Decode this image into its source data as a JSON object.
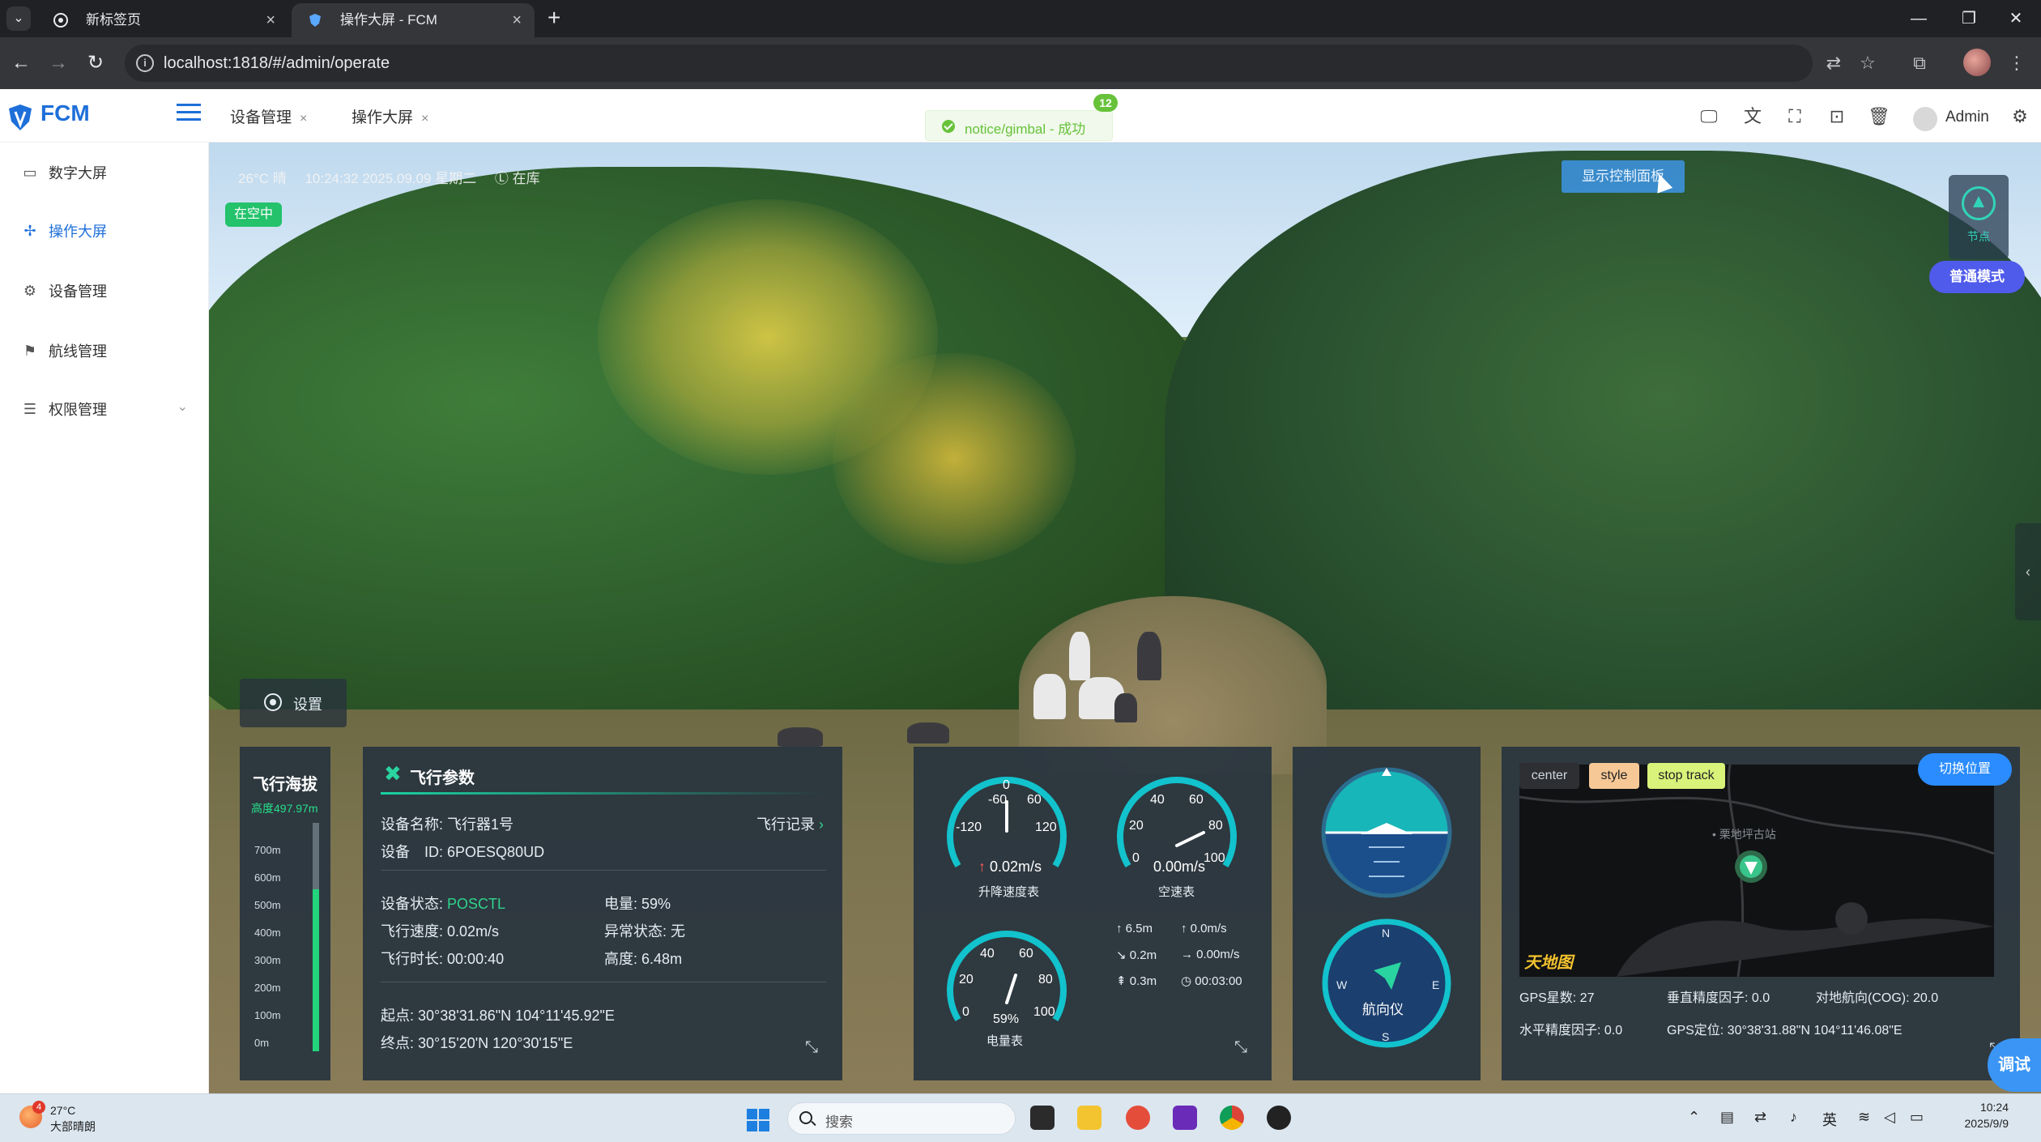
{
  "browser": {
    "tabs": [
      {
        "title": "新标签页",
        "active": false
      },
      {
        "title": "操作大屏 - FCM",
        "active": true
      }
    ],
    "url": "localhost:1818/#/admin/operate",
    "menu_glyph": "⌄",
    "close_glyph": "×",
    "newtab_glyph": "+",
    "back_glyph": "←",
    "forward_glyph": "→",
    "reload_glyph": "↻",
    "info_glyph": "i",
    "min_glyph": "—",
    "max_glyph": "❐",
    "win_close_glyph": "✕"
  },
  "app": {
    "logo": "FCM",
    "tabs": [
      {
        "label": "设备管理"
      },
      {
        "label": "操作大屏"
      }
    ],
    "tab_close": "×",
    "user": "Admin",
    "header_icons": [
      "monitor-icon",
      "translate-icon",
      "fullscreen-icon",
      "terminal-icon",
      "trash-icon",
      "settings-gear-icon"
    ]
  },
  "toast": {
    "message": "notice/gimbal - 成功",
    "badge": "12"
  },
  "sidebar": {
    "items": [
      {
        "label": "数字大屏",
        "icon": "dashboard-icon",
        "glyph": "▭"
      },
      {
        "label": "操作大屏",
        "icon": "crosshair-icon",
        "glyph": "✢",
        "active": true
      },
      {
        "label": "设备管理",
        "icon": "gear-icon",
        "glyph": "⚙"
      },
      {
        "label": "航线管理",
        "icon": "flag-icon",
        "glyph": "⚑"
      },
      {
        "label": "权限管理",
        "icon": "sliders-icon",
        "glyph": "☰",
        "expandable": true
      }
    ],
    "chevron_glyph": "⌄"
  },
  "video": {
    "osd": [
      "26°C 晴",
      "10:24:32 2025.09.09 星期二",
      "Ⓛ 在库"
    ],
    "status_badge": "在空中",
    "show_panel_button": "显示控制面板",
    "node_label": "节点",
    "mode_button": "普通模式",
    "collapse_glyph": "‹",
    "settings_label": "设置"
  },
  "altitude_panel": {
    "title": "飞行海拔",
    "value": "高度497.97m",
    "ticks": [
      "700m",
      "600m",
      "500m",
      "400m",
      "300m",
      "200m",
      "100m",
      "0m"
    ],
    "level": 0.71
  },
  "flight_params": {
    "title": "飞行参数",
    "device_name_label": "设备名称:",
    "device_name": "飞行器1号",
    "device_id_label": "设备　ID:",
    "device_id": "6POESQ80UD",
    "flight_log": "飞行记录",
    "status_label": "设备状态:",
    "status": "POSCTL",
    "battery_label": "电量:",
    "battery": "59%",
    "speed_label": "飞行速度:",
    "speed": "0.02m/s",
    "abnormal_label": "异常状态:",
    "abnormal": "无",
    "duration_label": "飞行时长:",
    "duration": "00:00:40",
    "height_label": "高度:",
    "height": "6.48m",
    "start_label": "起点:",
    "start": "30°38'31.86\"N  104°11'45.92\"E",
    "end_label": "终点:",
    "end": "30°15'20'N  120°30'15\"E",
    "close_glyph": "✖",
    "chevron_glyph": "›",
    "expand_glyph": "⤡"
  },
  "gauges": {
    "vertical": {
      "name": "升降速度表",
      "value": "0.02m/s",
      "arrow": "↑",
      "ticks": [
        "-60",
        "0",
        "60",
        "-120",
        "120"
      ]
    },
    "air": {
      "name": "空速表",
      "value": "0.00m/s",
      "ticks": [
        "40",
        "60",
        "20",
        "80",
        "0",
        "100"
      ]
    },
    "battery": {
      "name": "电量表",
      "value": "59%",
      "ticks": [
        "40",
        "60",
        "20",
        "80",
        "0",
        "100"
      ]
    },
    "stats": [
      {
        "text": "↑ 6.5m"
      },
      {
        "text": "↑ 0.0m/s"
      },
      {
        "text": "↘ 0.2m"
      },
      {
        "text": "→ 0.00m/s"
      },
      {
        "text": "⇞ 0.3m"
      },
      {
        "text": "◷ 00:03:00"
      }
    ],
    "expand_glyph": "⤡"
  },
  "attitude": {
    "compass_label": "航向仪",
    "n": "N",
    "s": "S",
    "e": "E",
    "w": "W"
  },
  "map": {
    "chips": [
      {
        "label": "center",
        "bg": "#2d2f33",
        "fg": "#cfd6dc"
      },
      {
        "label": "style",
        "bg": "#f6c896",
        "fg": "#222"
      },
      {
        "label": "stop track",
        "bg": "#d9f27a",
        "fg": "#222"
      }
    ],
    "switch_button": "切换位置",
    "place_label": "• 栗地坪古站",
    "watermark": "天地图",
    "gps_count": "GPS星数: 27",
    "vertical_accuracy": "垂直精度因子: 0.0",
    "cog": "对地航向(COG): 20.0",
    "horizontal_accuracy": "水平精度因子: 0.0",
    "gps_position": "GPS定位: 30°38'31.88\"N  104°11'46.08\"E",
    "expand_glyph": "⤡"
  },
  "debug_button": "调试",
  "taskbar": {
    "weather_badge": "4",
    "weather_temp": "27°C",
    "weather_desc": "大部晴朗",
    "search": "搜索",
    "tray_glyphs": [
      "⌃",
      "▤",
      "⇄",
      "♪",
      "英",
      "≋",
      "◁",
      "▭"
    ],
    "time": "10:24",
    "date": "2025/9/9"
  },
  "colors": {
    "accent": "#1e6fd9",
    "success": "#67c23a",
    "gauge": "#12c2cc",
    "panel": "#26323e"
  }
}
